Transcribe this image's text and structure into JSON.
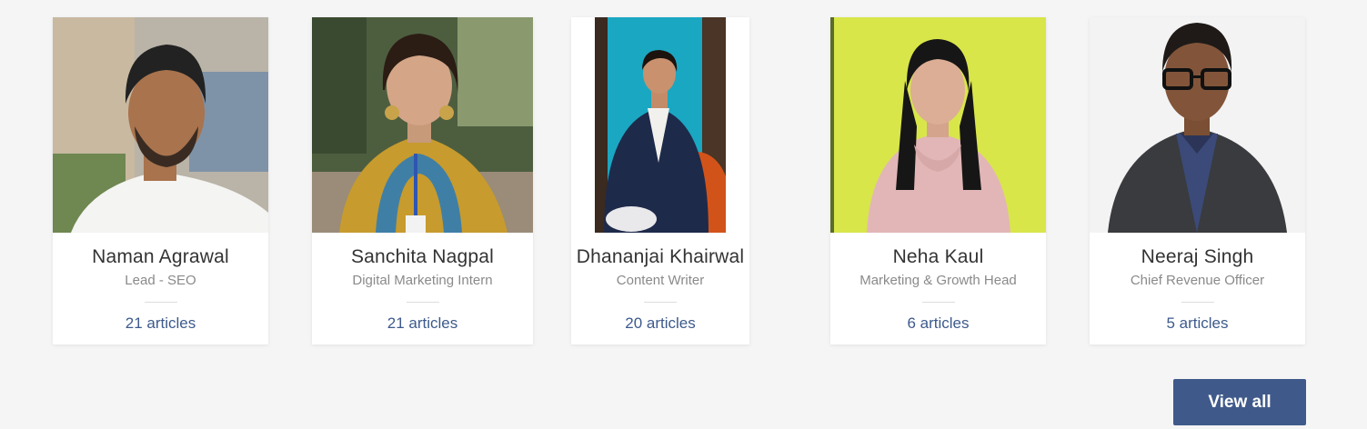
{
  "team": [
    {
      "name": "Naman Agrawal",
      "role": "Lead - SEO",
      "articles": "21 articles"
    },
    {
      "name": "Sanchita Nagpal",
      "role": "Digital Marketing Intern",
      "articles": "21 articles"
    },
    {
      "name": "Dhananjai Khairwal",
      "role": "Content Writer",
      "articles": "20 articles"
    },
    {
      "name": "Neha Kaul",
      "role": "Marketing & Growth Head",
      "articles": "6 articles"
    },
    {
      "name": "Neeraj Singh",
      "role": "Chief Revenue Officer",
      "articles": "5 articles"
    }
  ],
  "view_all_label": "View all",
  "colors": {
    "page_bg": "#f5f5f5",
    "card_bg": "#ffffff",
    "name_text": "#333333",
    "role_text": "#8a8a8a",
    "link_text": "#3d5a8c",
    "button_bg": "#3f5a8a",
    "button_text": "#ffffff"
  }
}
